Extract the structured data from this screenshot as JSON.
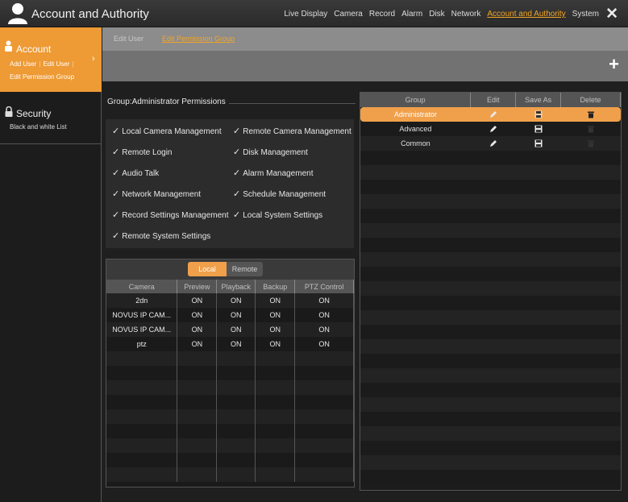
{
  "header": {
    "title": "Account and Authority",
    "nav": [
      "Live Display",
      "Camera",
      "Record",
      "Alarm",
      "Disk",
      "Network",
      "Account and Authority",
      "System"
    ],
    "active_nav": "Account and Authority",
    "close_icon": "close-icon"
  },
  "sidebar": {
    "account": {
      "title": "Account",
      "subs": [
        "Add User",
        "Edit User"
      ],
      "sub3": "Edit Permission Group"
    },
    "security": {
      "title": "Security",
      "sub": "Black and white List"
    }
  },
  "tabs": {
    "edit_user": "Edit User",
    "edit_group": "Edit Permission Group"
  },
  "permissions": {
    "title": "Group:Administrator Permissions",
    "left": [
      "Local Camera Management",
      "Remote Login",
      "Audio Talk",
      "Network Management",
      "Record Settings Management",
      "Remote System Settings"
    ],
    "right": [
      "Remote Camera Management",
      "Disk Management",
      "Alarm Management",
      "Schedule Management",
      "Local System Settings"
    ]
  },
  "camera": {
    "tab_local": "Local",
    "tab_remote": "Remote",
    "columns": [
      "Camera",
      "Preview",
      "Playback",
      "Backup",
      "PTZ Control"
    ],
    "rows": [
      [
        "2dn",
        "ON",
        "ON",
        "ON",
        "ON"
      ],
      [
        "NOVUS IP CAM...",
        "ON",
        "ON",
        "ON",
        "ON"
      ],
      [
        "NOVUS IP CAM...",
        "ON",
        "ON",
        "ON",
        "ON"
      ],
      [
        "ptz",
        "ON",
        "ON",
        "ON",
        "ON"
      ]
    ]
  },
  "groups": {
    "columns": [
      "Group",
      "Edit",
      "Save As",
      "Delete"
    ],
    "rows": [
      {
        "name": "Administrator",
        "selected": true
      },
      {
        "name": "Advanced",
        "selected": false
      },
      {
        "name": "Common",
        "selected": false
      }
    ]
  },
  "colors": {
    "accent": "#f0a04b",
    "sidebar_active": "#ee9a35"
  }
}
